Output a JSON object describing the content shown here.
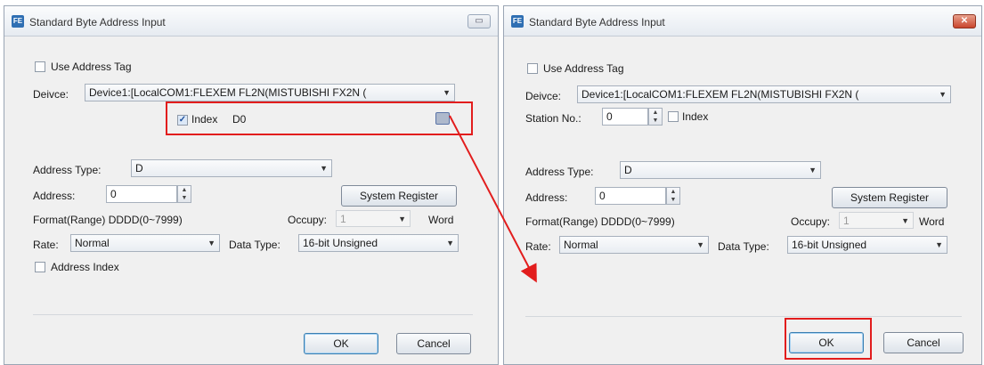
{
  "colors": {
    "highlight": "#e21d1d",
    "titlebar": "#e6ebf1",
    "dialog_bg": "#f0f0f0"
  },
  "left": {
    "title": "Standard Byte Address Input",
    "use_address_tag": "Use Address Tag",
    "device_label": "Deivce:",
    "device_value": "Device1:[LocalCOM1:FLEXEM FL2N(MISTUBISHI FX2N (",
    "index_label": "Index",
    "index_value": "D0",
    "address_type_label": "Address Type:",
    "address_type_value": "D",
    "address_label": "Address:",
    "address_value": "0",
    "system_register": "System Register",
    "format": "Format(Range) DDDD(0~7999)",
    "occupy_label": "Occupy:",
    "occupy_value": "1",
    "word": "Word",
    "rate_label": "Rate:",
    "rate_value": "Normal",
    "data_type_label": "Data Type:",
    "data_type_value": "16-bit Unsigned",
    "address_index": "Address Index",
    "ok": "OK",
    "cancel": "Cancel"
  },
  "right": {
    "title": "Standard Byte Address Input",
    "use_address_tag": "Use Address Tag",
    "device_label": "Deivce:",
    "device_value": "Device1:[LocalCOM1:FLEXEM FL2N(MISTUBISHI FX2N (",
    "station_label": "Station No.:",
    "station_value": "0",
    "index_label": "Index",
    "address_type_label": "Address Type:",
    "address_type_value": "D",
    "address_label": "Address:",
    "address_value": "0",
    "system_register": "System Register",
    "format": "Format(Range) DDDD(0~7999)",
    "occupy_label": "Occupy:",
    "occupy_value": "1",
    "word": "Word",
    "rate_label": "Rate:",
    "rate_value": "Normal",
    "data_type_label": "Data Type:",
    "data_type_value": "16-bit Unsigned",
    "ok": "OK",
    "cancel": "Cancel"
  }
}
